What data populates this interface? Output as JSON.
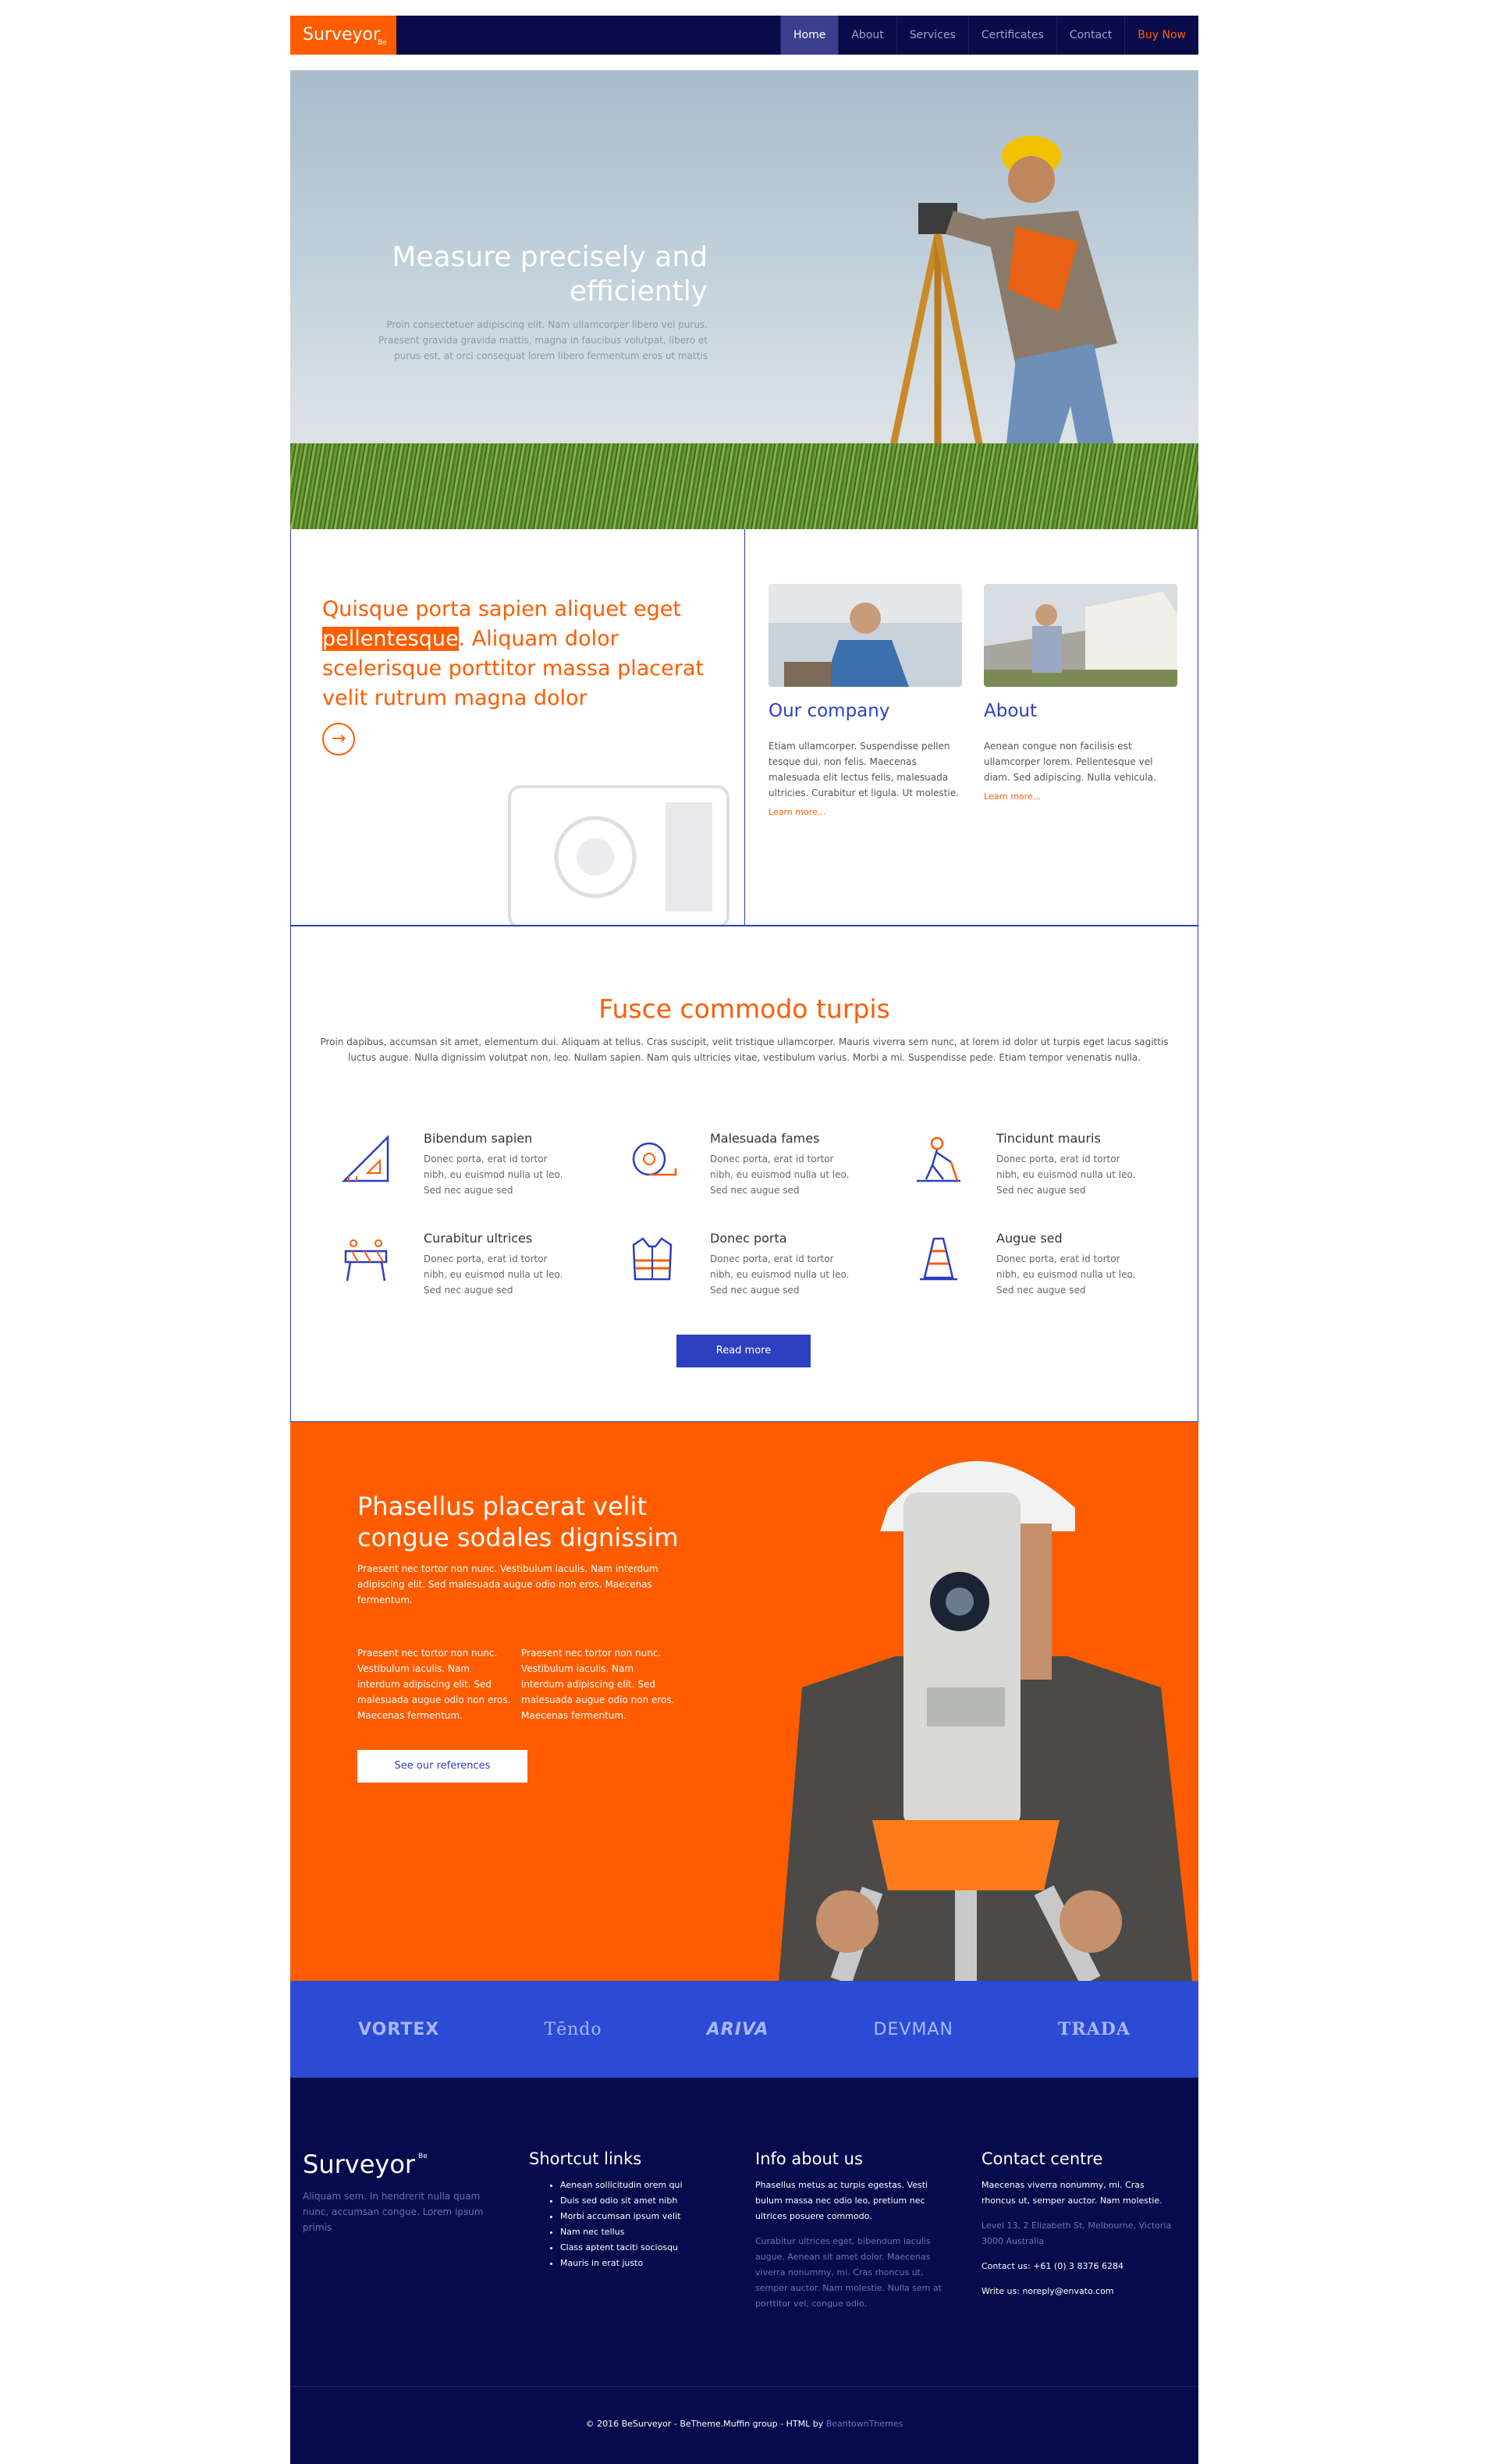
{
  "header": {
    "logo": "Surveyor",
    "logo_sup": "Be",
    "nav": [
      "Home",
      "About",
      "Services",
      "Certificates",
      "Contact",
      "Buy Now"
    ]
  },
  "hero": {
    "title": "Measure precisely and efficiently",
    "text": "Proin consectetuer adipiscing elit. Nam ullamcorper libero vel purus. Praesent gravida gravida mattis, magna in faucibus volutpat, libero et purus est, at orci consequat lorem libero fermentum eros ut mattis"
  },
  "intro": {
    "heading_before": "Quisque porta sapien aliquet eget ",
    "heading_highlight": "pellentesque",
    "heading_after": ". Aliquam dolor scelerisque porttitor massa placerat velit rutrum magna dolor",
    "arrow_icon": "arrow-right-icon",
    "cards": [
      {
        "title": "Our company",
        "text": "Etiam ullamcorper. Suspendisse pellen tesque dui, non felis. Maecenas malesuada elit lectus felis, malesuada ultricies. Curabitur et ligula. Ut molestie.",
        "more": "Learn more..."
      },
      {
        "title": "About",
        "text": "Aenean congue non facilisis est ullamcorper lorem. Pellentesque vel diam. Sed adipiscing. Nulla vehicula.",
        "more": "Learn more..."
      }
    ]
  },
  "services": {
    "title": "Fusce commodo turpis",
    "intro": "Proin dapibus, accumsan sit amet, elementum dui. Aliquam at tellus. Cras suscipit, velit tristique ullamcorper. Mauris viverra sem nunc, at lorem id dolor ut turpis eget lacus sagittis luctus augue. Nulla dignissim volutpat non, leo. Nullam sapien. Nam quis ultricies vitae, vestibulum varius. Morbi a mi. Suspendisse pede. Etiam tempor venenatis nulla.",
    "items": [
      {
        "title": "Bibendum sapien",
        "text": "Donec porta, erat id tortor nibh, eu euismod nulla ut leo. Sed nec augue sed",
        "icon": "set-square-icon"
      },
      {
        "title": "Malesuada fames",
        "text": "Donec porta, erat id tortor nibh, eu euismod nulla ut leo. Sed nec augue sed",
        "icon": "tape-measure-icon"
      },
      {
        "title": "Tincidunt mauris",
        "text": "Donec porta, erat id tortor nibh, eu euismod nulla ut leo. Sed nec augue sed",
        "icon": "road-worker-icon"
      },
      {
        "title": "Curabitur ultrices",
        "text": "Donec porta, erat id tortor nibh, eu euismod nulla ut leo. Sed nec augue sed",
        "icon": "barrier-icon"
      },
      {
        "title": "Donec porta",
        "text": "Donec porta, erat id tortor nibh, eu euismod nulla ut leo. Sed nec augue sed",
        "icon": "safety-vest-icon"
      },
      {
        "title": "Augue sed",
        "text": "Donec porta, erat id tortor nibh, eu euismod nulla ut leo. Sed nec augue sed",
        "icon": "traffic-cone-icon"
      }
    ],
    "button": "Read more"
  },
  "orange": {
    "title": "Phasellus placerat velit congue sodales dignissim",
    "lead": "Praesent nec tortor non nunc. Vestibulum iaculis. Nam interdum adipiscing elit. Sed malesuada augue odio non eros. Maecenas fermentum.",
    "col1": "Praesent nec tortor non nunc. Vestibulum iaculis. Nam interdum adipiscing elit. Sed malesuada augue odio non eros. Maecenas fermentum.",
    "col2": "Praesent nec tortor non nunc. Vestibulum iaculis. Nam interdum adipiscing elit. Sed malesuada augue odio non eros. Maecenas fermentum.",
    "button": "See our references"
  },
  "brands": [
    "VORTEX",
    "Tēndo",
    "ARIVA",
    "DEVMAN",
    "TRADA"
  ],
  "footer": {
    "logo": "Surveyor",
    "logo_sup": "Be",
    "about": "Aliquam sem. In hendrerit nulla quam nunc, accumsan congue. Lorem ipsum primis",
    "shortcut_title": "Shortcut links",
    "links": [
      "Aenean sollicitudin orem qui",
      "Duis sed odio sit amet nibh",
      "Morbi accumsan ipsum velit",
      "Nam nec tellus",
      "Class aptent taciti sociosqu",
      "Mauris in erat justo"
    ],
    "info_title": "Info about us",
    "info_text": "Phasellus metus ac turpis egestas. Vesti bulum massa nec odio leo, pretium nec ultrices posuere commodo.",
    "info_dim": "Curabitur ultrices eget, bibendum iaculis augue. Aenean sit amet dolor. Maecenas viverra nonummy, mi. Cras rhoncus ut, semper auctor. Nam molestie. Nulla sem at porttitor vel, congue odio.",
    "contact_title": "Contact centre",
    "contact_text": "Maecenas viverra nonummy, mi. Cras rhoncus ut, semper auctor. Nam molestie.",
    "contact_address": "Level 13, 2 Elizabeth St, Melbourne, Victoria 3000 Australia",
    "contact_phone": "Contact us: +61 (0) 3 8376 6284",
    "contact_email": "Write us: noreply@envato.com",
    "copyright": "© 2016 BeSurveyor - BeTheme.Muffin group - HTML by ",
    "copyright_link": "BeantownThemes"
  },
  "colors": {
    "navy": "#0a0b4a",
    "orange": "#ff5c00",
    "blue": "#2c3fbf"
  }
}
